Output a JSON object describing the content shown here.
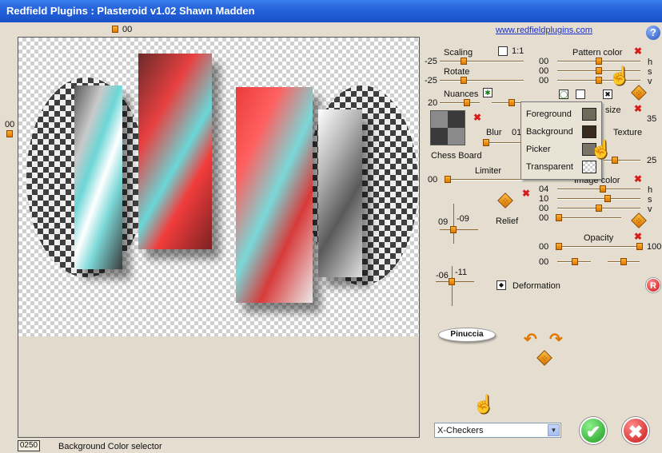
{
  "window": {
    "title": "Redfield Plugins : Plasteroid v1.02   Shawn Madden"
  },
  "link": "www.redfieldplugins.com",
  "canvas": {
    "top_value": "00",
    "left_value": "00"
  },
  "controls": {
    "scaling": {
      "label": "Scaling",
      "value": "-25"
    },
    "one_to_one": {
      "label": "1:1"
    },
    "rotate": {
      "label": "Rotate",
      "value": "-25"
    },
    "nuances": {
      "label": "Nuances",
      "value": "20"
    },
    "chess_board": {
      "label": "Chess Board"
    },
    "blur": {
      "label": "Blur",
      "value": "01"
    },
    "limiter": {
      "label": "Limiter",
      "value": "00"
    },
    "relief": {
      "label": "Relief",
      "x_value": "09",
      "y_value": "-09"
    },
    "deformation": {
      "label": "Deformation",
      "x_value": "-06",
      "y_value": "-11"
    },
    "pattern_color": {
      "label": "Pattern color",
      "h_label": "h",
      "s_label": "s",
      "v_label": "v",
      "h_value": "00",
      "s_value": "00",
      "v_value": "00"
    },
    "size": {
      "label": "size",
      "value": "35"
    },
    "texture": {
      "label": "Texture",
      "value": "25"
    },
    "image_color": {
      "label": "Image color",
      "h_label": "h",
      "s_label": "s",
      "v_label": "v",
      "h_value": "04",
      "s_value": "10",
      "v_value": "00",
      "extra_value": "00"
    },
    "opacity": {
      "label": "Opacity",
      "min_value": "00",
      "max_value": "100",
      "second_value": "00"
    }
  },
  "color_popup": {
    "items": [
      {
        "label": "Foreground",
        "color": "#6e6a5a"
      },
      {
        "label": "Background",
        "color": "#3a2a1e"
      },
      {
        "label": "Picker",
        "color": "#7a7468"
      },
      {
        "label": "Transparent",
        "color": "transparent"
      }
    ]
  },
  "badge": {
    "label": "Pinuccia"
  },
  "preset": {
    "selected": "X-Checkers"
  },
  "buttons": {
    "ok_symbol": "✔",
    "cancel_symbol": "✖",
    "help_symbol": "?",
    "reset_symbol": "R"
  },
  "status": {
    "code": "0250",
    "text": "Background Color selector"
  },
  "colors": {
    "title_bar": "#2563dc",
    "accent_knob": "#e07800",
    "close_red": "#d81c1c"
  }
}
